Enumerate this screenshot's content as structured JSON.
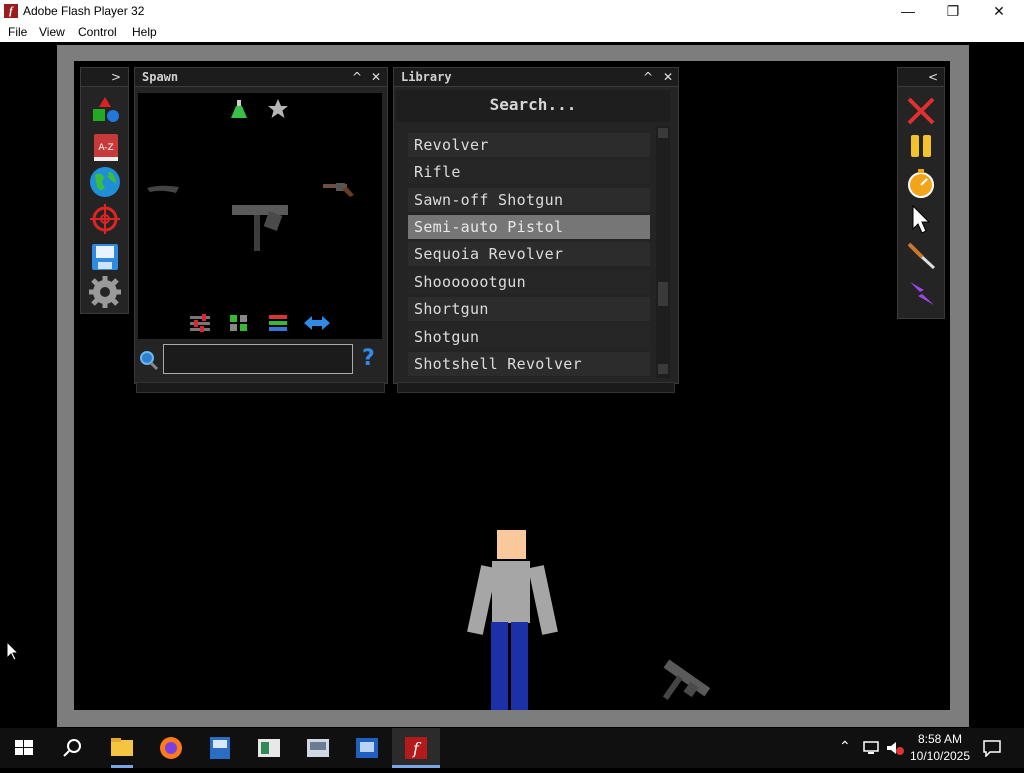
{
  "window": {
    "title": "Adobe Flash Player 32",
    "minimize": "—",
    "maximize": "❐",
    "close": "✕"
  },
  "menu": [
    "File",
    "View",
    "Control",
    "Help"
  ],
  "toolbar_left": {
    "expand": ">",
    "tools": [
      "shapes-icon",
      "a-z-icon",
      "world-icon",
      "target-icon",
      "save-icon",
      "settings-icon"
    ],
    "az_label": "A-Z"
  },
  "spawn": {
    "title": "Spawn",
    "minimize": "^",
    "close": "✕",
    "search_placeholder": "",
    "help": "?"
  },
  "library": {
    "title": "Library",
    "minimize": "^",
    "close": "✕",
    "search_label": "Search...",
    "items": [
      "Revolver",
      "Rifle",
      "Sawn-off Shotgun",
      "Semi-auto Pistol",
      "Sequoia Revolver",
      "Shooooootgun",
      "Shortgun",
      "Shotgun",
      "Shotshell Revolver"
    ],
    "selected_index": 3
  },
  "toolbar_right": {
    "collapse": "<",
    "tools": [
      "delete-icon",
      "pause-icon",
      "timer-icon",
      "pointer-icon",
      "knife-icon",
      "lightning-icon"
    ]
  },
  "taskbar": {
    "apps": [
      "start-icon",
      "search-icon",
      "file-explorer-icon",
      "firefox-icon",
      "app-icon-1",
      "app-icon-2",
      "app-icon-3",
      "app-icon-4",
      "flash-icon"
    ],
    "time": "8:58 AM",
    "date": "10/10/2025"
  },
  "colors": {
    "selected_row": "#767676",
    "stage_border": "#7d7d7d",
    "skin": "#f9c89b",
    "shirt": "#a6a6a6",
    "pants": "#1c30a8"
  }
}
